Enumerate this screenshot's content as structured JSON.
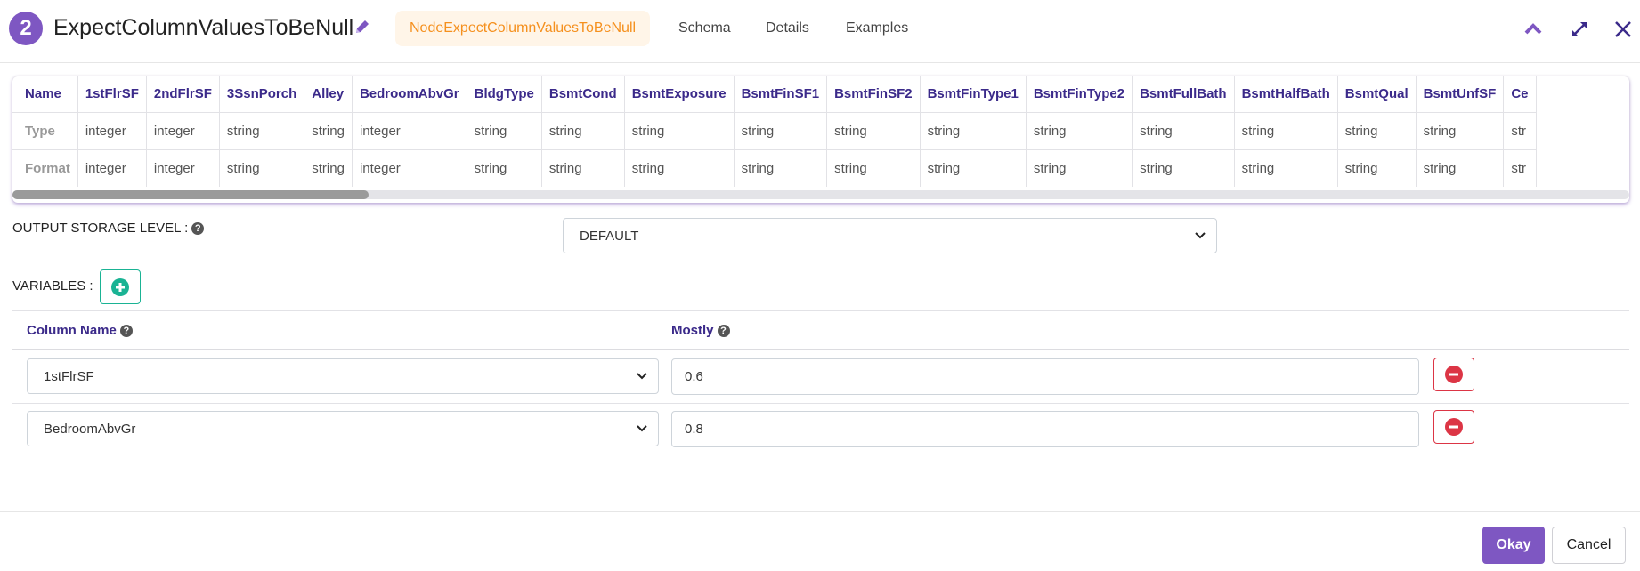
{
  "header": {
    "step": "2",
    "title": "ExpectColumnValuesToBeNull",
    "tabs": [
      {
        "label": "NodeExpectColumnValuesToBeNull",
        "active": true
      },
      {
        "label": "Schema"
      },
      {
        "label": "Details"
      },
      {
        "label": "Examples"
      }
    ],
    "icons": [
      "chevron-up-icon",
      "expand-icon",
      "close-icon"
    ]
  },
  "schema": {
    "row_labels": [
      "Name",
      "Type",
      "Format"
    ],
    "columns": [
      {
        "name": "1stFlrSF",
        "type": "integer",
        "format": "integer"
      },
      {
        "name": "2ndFlrSF",
        "type": "integer",
        "format": "integer"
      },
      {
        "name": "3SsnPorch",
        "type": "string",
        "format": "string"
      },
      {
        "name": "Alley",
        "type": "string",
        "format": "string"
      },
      {
        "name": "BedroomAbvGr",
        "type": "integer",
        "format": "integer"
      },
      {
        "name": "BldgType",
        "type": "string",
        "format": "string"
      },
      {
        "name": "BsmtCond",
        "type": "string",
        "format": "string"
      },
      {
        "name": "BsmtExposure",
        "type": "string",
        "format": "string"
      },
      {
        "name": "BsmtFinSF1",
        "type": "string",
        "format": "string"
      },
      {
        "name": "BsmtFinSF2",
        "type": "string",
        "format": "string"
      },
      {
        "name": "BsmtFinType1",
        "type": "string",
        "format": "string"
      },
      {
        "name": "BsmtFinType2",
        "type": "string",
        "format": "string"
      },
      {
        "name": "BsmtFullBath",
        "type": "string",
        "format": "string"
      },
      {
        "name": "BsmtHalfBath",
        "type": "string",
        "format": "string"
      },
      {
        "name": "BsmtQual",
        "type": "string",
        "format": "string"
      },
      {
        "name": "BsmtUnfSF",
        "type": "string",
        "format": "string"
      },
      {
        "name": "Ce",
        "type": "str",
        "format": "str"
      }
    ],
    "scroll_fraction": 0.22
  },
  "storage": {
    "label": "OUTPUT STORAGE LEVEL :",
    "value": "DEFAULT"
  },
  "variables": {
    "label": "VARIABLES :",
    "col_name_header": "Column Name",
    "mostly_header": "Mostly",
    "rows": [
      {
        "column": "1stFlrSF",
        "mostly": "0.6"
      },
      {
        "column": "BedroomAbvGr",
        "mostly": "0.8"
      }
    ]
  },
  "footer": {
    "ok": "Okay",
    "cancel": "Cancel"
  },
  "colors": {
    "accent": "#7e57c2",
    "tab_active": "#f5901e",
    "header_text": "#3b2a8a",
    "danger": "#dc3545",
    "add": "#1ab394"
  }
}
